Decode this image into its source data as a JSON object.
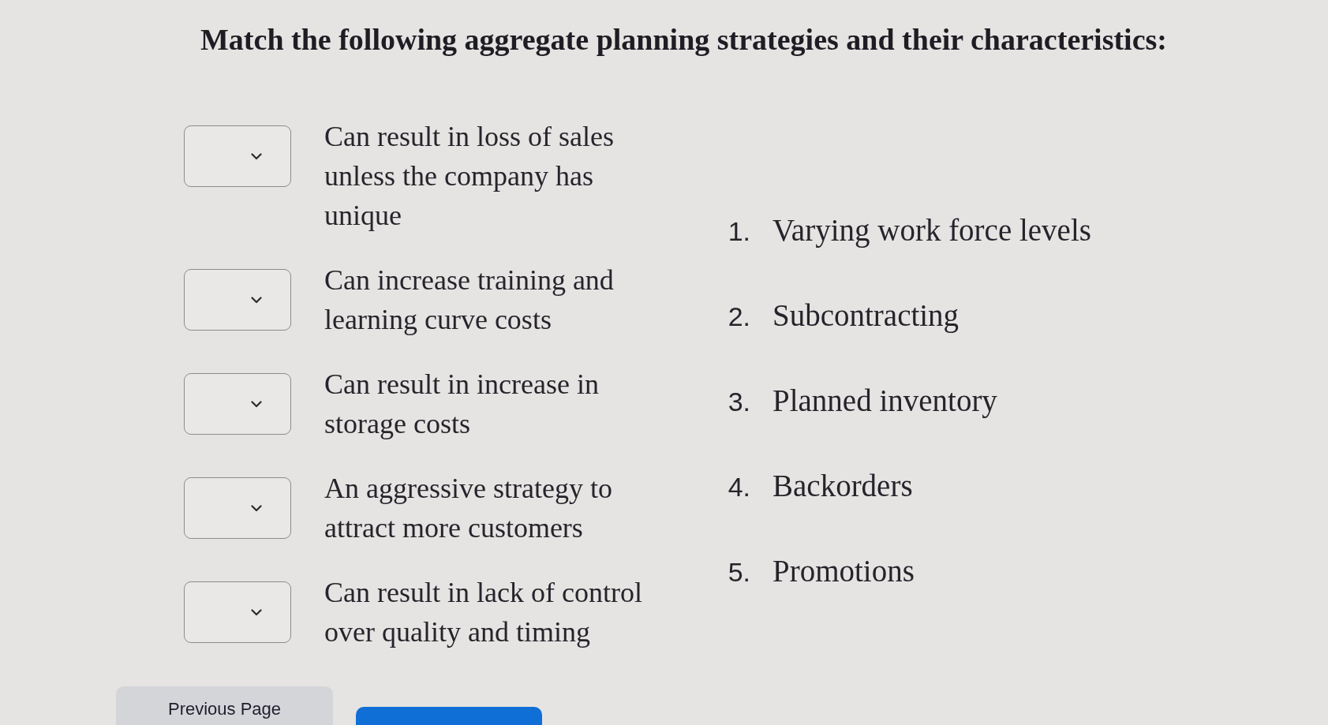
{
  "title": "Match the following aggregate planning strategies and their characteristics:",
  "rows": [
    {
      "description": "Can result in loss of sales unless the company has unique"
    },
    {
      "description": "Can increase training and learning curve costs"
    },
    {
      "description": "Can result in increase in storage costs"
    },
    {
      "description": "An aggressive strategy to attract more customers"
    },
    {
      "description": "Can result in lack of control over quality and timing"
    }
  ],
  "options": [
    {
      "number": "1.",
      "label": "Varying work force levels"
    },
    {
      "number": "2.",
      "label": "Subcontracting"
    },
    {
      "number": "3.",
      "label": "Planned inventory"
    },
    {
      "number": "4.",
      "label": "Backorders"
    },
    {
      "number": "5.",
      "label": "Promotions"
    }
  ],
  "buttons": [
    {
      "kind": "secondary",
      "label": "Previous Page"
    },
    {
      "kind": "primary"
    }
  ]
}
